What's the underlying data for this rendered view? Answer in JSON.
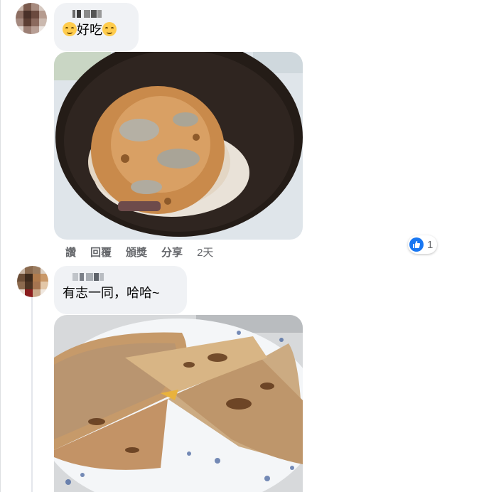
{
  "comments": [
    {
      "text_before_emoji": "",
      "text": "好吃",
      "emoji_icons": [
        "smiling-face-icon",
        "smiling-face-icon"
      ]
    },
    {
      "text": "有志一同，哈哈~"
    }
  ],
  "actions": {
    "like": "讚",
    "reply": "回覆",
    "award": "頒獎",
    "share": "分享",
    "time": "2天"
  },
  "reactions": {
    "icon": "like-icon",
    "count": "1",
    "color": "#1877f2"
  }
}
